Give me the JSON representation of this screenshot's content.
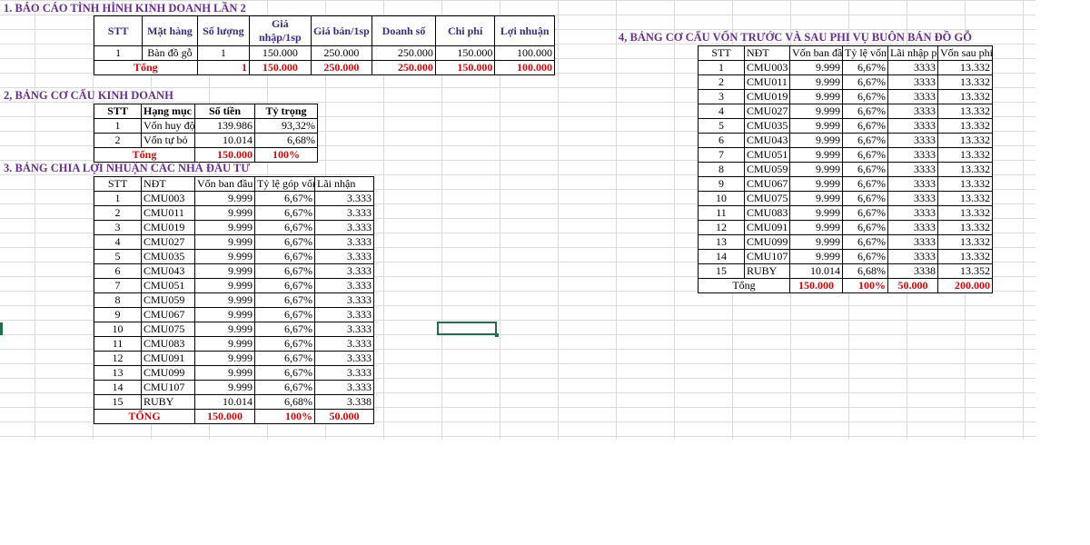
{
  "section1": {
    "title": "1. BÁO CÁO TÌNH HÌNH KINH DOANH LẦN 2",
    "headers": [
      "STT",
      "Mặt hàng",
      "Số lượng",
      "Giá nhập/1sp",
      "Giá bán/1sp",
      "Doanh số",
      "Chi phí",
      "Lợi nhuận"
    ],
    "row": [
      "1",
      "Bàn đồ gỗ",
      "1",
      "150.000",
      "250.000",
      "250.000",
      "150.000",
      "100.000"
    ],
    "total": [
      "Tổng",
      "1",
      "150.000",
      "250.000",
      "250.000",
      "150.000",
      "100.000"
    ]
  },
  "section2": {
    "title": "2, BẢNG CƠ CẤU KINH DOANH",
    "headers": [
      "STT",
      "Hạng mục",
      "Số tiền",
      "Tỷ trọng"
    ],
    "rows": [
      [
        "1",
        "Vốn huy độ",
        "139.986",
        "93,32%"
      ],
      [
        "2",
        "Vốn tự bỏ",
        "10.014",
        "6,68%"
      ]
    ],
    "total": [
      "Tổng",
      "150.000",
      "100%"
    ]
  },
  "section3": {
    "title": "3. BẢNG CHIA LỢI NHUẬN CÁC NHÀ ĐẦU TƯ",
    "headers": [
      "STT",
      "NĐT",
      "Vốn ban đầu",
      "Tỷ lệ góp vốn",
      "Lãi nhận"
    ],
    "rows": [
      [
        "1",
        "CMU003",
        "9.999",
        "6,67%",
        "3.333"
      ],
      [
        "2",
        "CMU011",
        "9.999",
        "6,67%",
        "3.333"
      ],
      [
        "3",
        "CMU019",
        "9.999",
        "6,67%",
        "3.333"
      ],
      [
        "4",
        "CMU027",
        "9.999",
        "6,67%",
        "3.333"
      ],
      [
        "5",
        "CMU035",
        "9.999",
        "6,67%",
        "3.333"
      ],
      [
        "6",
        "CMU043",
        "9.999",
        "6,67%",
        "3.333"
      ],
      [
        "7",
        "CMU051",
        "9.999",
        "6,67%",
        "3.333"
      ],
      [
        "8",
        "CMU059",
        "9.999",
        "6,67%",
        "3.333"
      ],
      [
        "9",
        "CMU067",
        "9.999",
        "6,67%",
        "3.333"
      ],
      [
        "10",
        "CMU075",
        "9.999",
        "6,67%",
        "3.333"
      ],
      [
        "11",
        "CMU083",
        "9.999",
        "6,67%",
        "3.333"
      ],
      [
        "12",
        "CMU091",
        "9.999",
        "6,67%",
        "3.333"
      ],
      [
        "13",
        "CMU099",
        "9.999",
        "6,67%",
        "3.333"
      ],
      [
        "14",
        "CMU107",
        "9.999",
        "6,67%",
        "3.333"
      ],
      [
        "15",
        "RUBY",
        "10.014",
        "6,68%",
        "3.338"
      ]
    ],
    "total": [
      "TỔNG",
      "150.000",
      "100%",
      "50.000"
    ]
  },
  "section4": {
    "title": "4, BẢNG CƠ CẤU VỐN TRƯỚC VÀ SAU PHI VỤ BUÔN BÁN ĐỒ GỖ",
    "headers": [
      "STT",
      "NĐT",
      "Vốn ban đầu",
      "Tỷ lệ vốn",
      "Lãi nhập p",
      "Vốn sau phi vụ"
    ],
    "rows": [
      [
        "1",
        "CMU003",
        "9.999",
        "6,67%",
        "3333",
        "13.332"
      ],
      [
        "2",
        "CMU011",
        "9.999",
        "6,67%",
        "3333",
        "13.332"
      ],
      [
        "3",
        "CMU019",
        "9.999",
        "6,67%",
        "3333",
        "13.332"
      ],
      [
        "4",
        "CMU027",
        "9.999",
        "6,67%",
        "3333",
        "13.332"
      ],
      [
        "5",
        "CMU035",
        "9.999",
        "6,67%",
        "3333",
        "13.332"
      ],
      [
        "6",
        "CMU043",
        "9.999",
        "6,67%",
        "3333",
        "13.332"
      ],
      [
        "7",
        "CMU051",
        "9.999",
        "6,67%",
        "3333",
        "13.332"
      ],
      [
        "8",
        "CMU059",
        "9.999",
        "6,67%",
        "3333",
        "13.332"
      ],
      [
        "9",
        "CMU067",
        "9.999",
        "6,67%",
        "3333",
        "13.332"
      ],
      [
        "10",
        "CMU075",
        "9.999",
        "6,67%",
        "3333",
        "13.332"
      ],
      [
        "11",
        "CMU083",
        "9.999",
        "6,67%",
        "3333",
        "13.332"
      ],
      [
        "12",
        "CMU091",
        "9.999",
        "6,67%",
        "3333",
        "13.332"
      ],
      [
        "13",
        "CMU099",
        "9.999",
        "6,67%",
        "3333",
        "13.332"
      ],
      [
        "14",
        "CMU107",
        "9.999",
        "6,67%",
        "3333",
        "13.332"
      ],
      [
        "15",
        "RUBY",
        "10.014",
        "6,68%",
        "3338",
        "13.352"
      ]
    ],
    "total": [
      "Tổng",
      "150.000",
      "100%",
      "50.000",
      "200.000"
    ]
  },
  "colors": {
    "heading": "#6b2c8f",
    "total_red": "#e00000",
    "selection": "#1e7145"
  }
}
